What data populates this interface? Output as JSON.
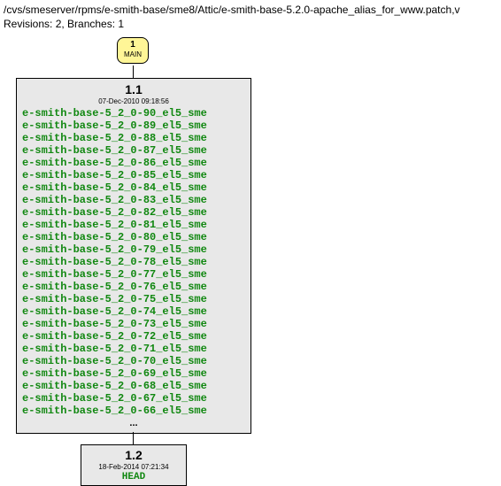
{
  "header": {
    "path": "/cvs/smeserver/rpms/e-smith-base/sme8/Attic/e-smith-base-5.2.0-apache_alias_for_www.patch,v",
    "revisions": "Revisions: 2, Branches: 1"
  },
  "main_node": {
    "number": "1",
    "label": "MAIN"
  },
  "node_11": {
    "version": "1.1",
    "date": "07-Dec-2010 09:18:56",
    "tags": [
      "e-smith-base-5_2_0-90_el5_sme",
      "e-smith-base-5_2_0-89_el5_sme",
      "e-smith-base-5_2_0-88_el5_sme",
      "e-smith-base-5_2_0-87_el5_sme",
      "e-smith-base-5_2_0-86_el5_sme",
      "e-smith-base-5_2_0-85_el5_sme",
      "e-smith-base-5_2_0-84_el5_sme",
      "e-smith-base-5_2_0-83_el5_sme",
      "e-smith-base-5_2_0-82_el5_sme",
      "e-smith-base-5_2_0-81_el5_sme",
      "e-smith-base-5_2_0-80_el5_sme",
      "e-smith-base-5_2_0-79_el5_sme",
      "e-smith-base-5_2_0-78_el5_sme",
      "e-smith-base-5_2_0-77_el5_sme",
      "e-smith-base-5_2_0-76_el5_sme",
      "e-smith-base-5_2_0-75_el5_sme",
      "e-smith-base-5_2_0-74_el5_sme",
      "e-smith-base-5_2_0-73_el5_sme",
      "e-smith-base-5_2_0-72_el5_sme",
      "e-smith-base-5_2_0-71_el5_sme",
      "e-smith-base-5_2_0-70_el5_sme",
      "e-smith-base-5_2_0-69_el5_sme",
      "e-smith-base-5_2_0-68_el5_sme",
      "e-smith-base-5_2_0-67_el5_sme",
      "e-smith-base-5_2_0-66_el5_sme"
    ],
    "ellipsis": "..."
  },
  "node_12": {
    "version": "1.2",
    "date": "18-Feb-2014 07:21:34",
    "head": "HEAD"
  }
}
